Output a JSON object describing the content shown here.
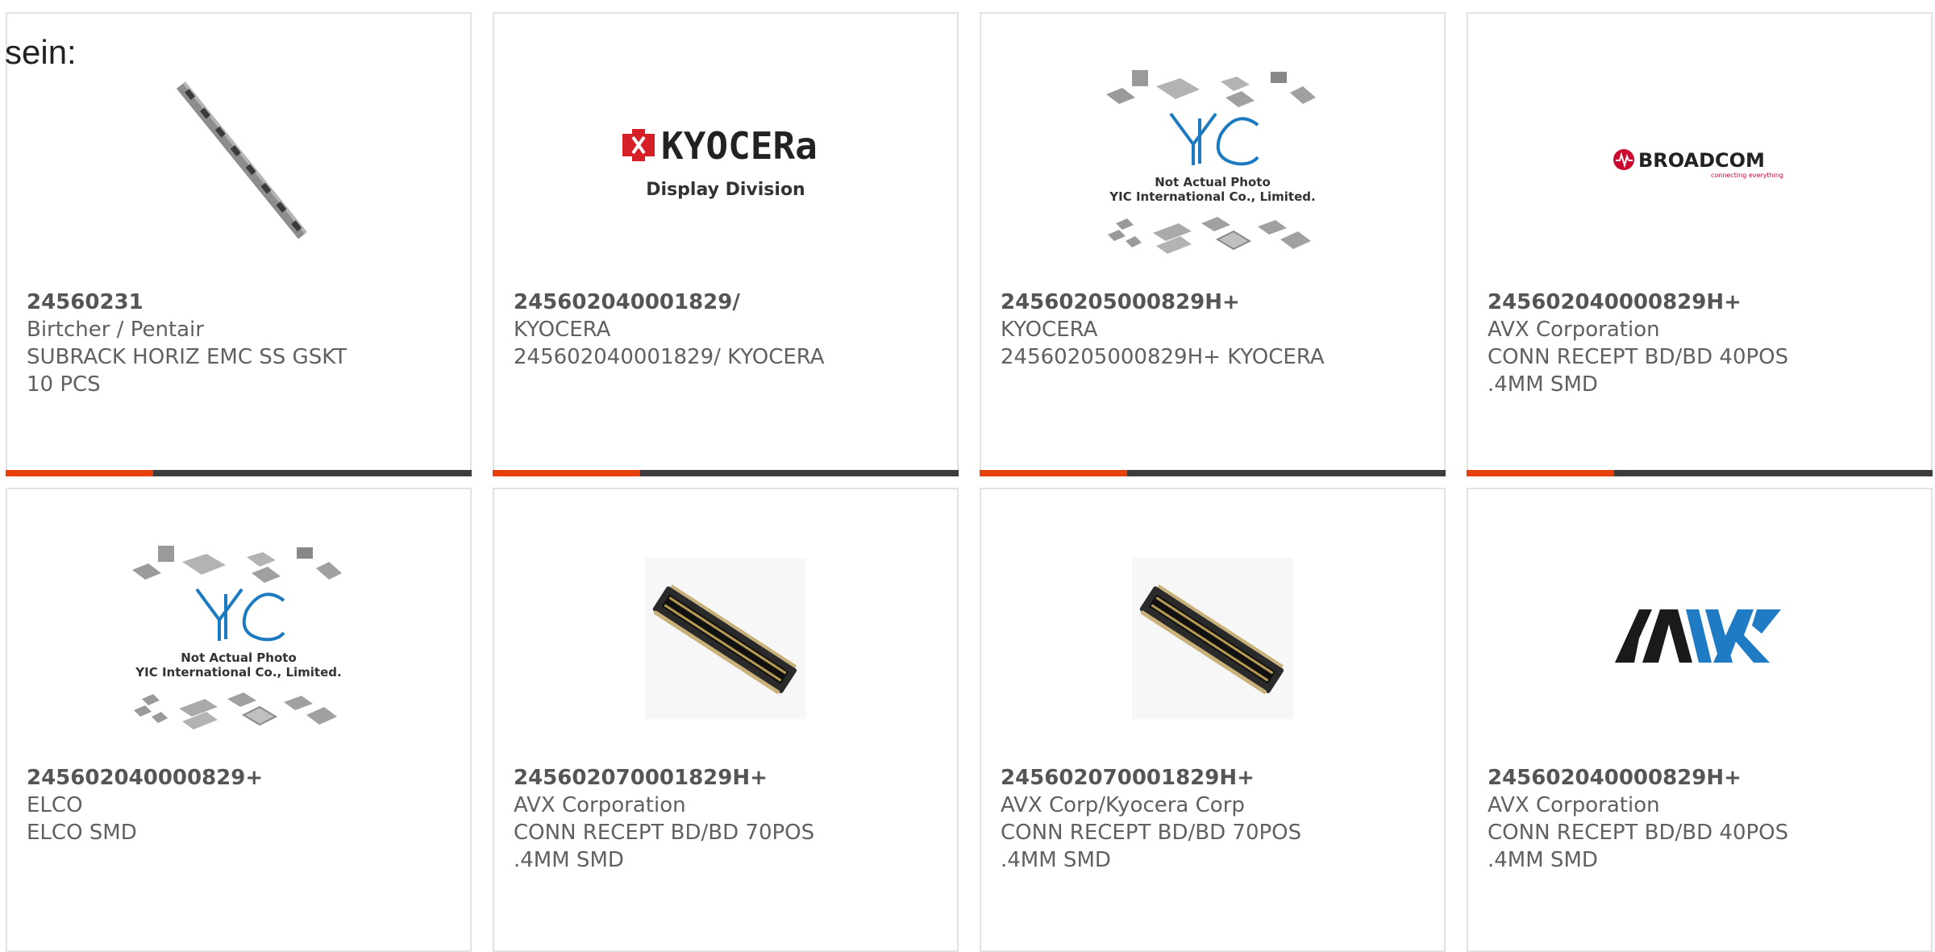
{
  "intro_text": "sein:",
  "colors": {
    "accent": "#e8400c",
    "bar": "#3d3d3d",
    "border": "#e2e2e2",
    "text": "#606060"
  },
  "products": [
    {
      "part": "24560231",
      "maker": "Birtcher / Pentair",
      "desc1": "SUBRACK HORIZ EMC SS GSKT",
      "desc2": "10 PCS",
      "image": "metal-strip-photo"
    },
    {
      "part": "245602040001829/",
      "maker": "KYOCERA",
      "desc1": "245602040001829/ KYOCERA",
      "desc2": "",
      "image": "kyocera-logo",
      "logo_text": "KYOCERa",
      "logo_sub": "Display Division"
    },
    {
      "part": "24560205000829H+",
      "maker": "KYOCERA",
      "desc1": "24560205000829H+ KYOCERA",
      "desc2": "",
      "image": "yic-placeholder",
      "ph1": "Not Actual Photo",
      "ph2": "YIC International Co., Limited."
    },
    {
      "part": "245602040000829H+",
      "maker": "AVX Corporation",
      "desc1": "CONN RECEPT BD/BD 40POS",
      "desc2": ".4MM SMD",
      "image": "broadcom-logo",
      "logo_text": "BROADCOM",
      "logo_sub": "connecting everything"
    },
    {
      "part": "245602040000829+",
      "maker": "ELCO",
      "desc1": "ELCO SMD",
      "desc2": "",
      "image": "yic-placeholder",
      "ph1": "Not Actual Photo",
      "ph2": "YIC International Co., Limited."
    },
    {
      "part": "245602070001829H+",
      "maker": "AVX Corporation",
      "desc1": "CONN RECEPT BD/BD 70POS",
      "desc2": ".4MM SMD",
      "image": "connector-photo"
    },
    {
      "part": "245602070001829H+",
      "maker": "AVX Corp/Kyocera Corp",
      "desc1": "CONN RECEPT BD/BD 70POS",
      "desc2": ".4MM SMD",
      "image": "connector-photo"
    },
    {
      "part": "245602040000829H+",
      "maker": "AVX Corporation",
      "desc1": "CONN RECEPT BD/BD 40POS",
      "desc2": ".4MM SMD",
      "image": "avx-logo",
      "logo_text": "AVX"
    }
  ]
}
